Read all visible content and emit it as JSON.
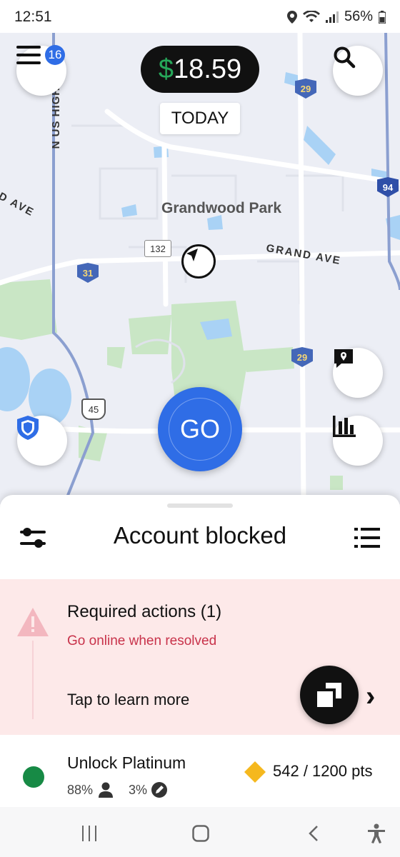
{
  "status_bar": {
    "time": "12:51",
    "battery": "56%"
  },
  "map": {
    "menu_badge": "16",
    "earnings": {
      "currency": "$",
      "amount": "18.59"
    },
    "period_label": "TODAY",
    "place_label": "Grandwood Park",
    "road_labels": {
      "grand_ave": "GRAND AVE",
      "left_ave": "D AVE",
      "us_highway": "N US HIGH"
    },
    "shields": {
      "s29_top": "29",
      "s94": "94",
      "s132": "132",
      "s31": "31",
      "s29_mid": "29",
      "s45": "45",
      "s45_top": "45"
    },
    "go_label": "GO"
  },
  "sheet": {
    "title": "Account blocked",
    "required_actions": {
      "title": "Required actions (1)",
      "subtitle": "Go online when resolved",
      "link": "Tap to learn more",
      "chevron": "›"
    },
    "rewards": {
      "title": "Unlock Platinum",
      "acceptance": "88%",
      "cancellation": "3%",
      "points": "542 / 1200 pts"
    }
  },
  "colors": {
    "brand_blue": "#2f6de6",
    "earnings_green": "#26a85a",
    "alert_bg": "#fde9e9",
    "alert_red": "#c8324a",
    "status_green": "#178a45",
    "diamond": "#f5b81e"
  }
}
